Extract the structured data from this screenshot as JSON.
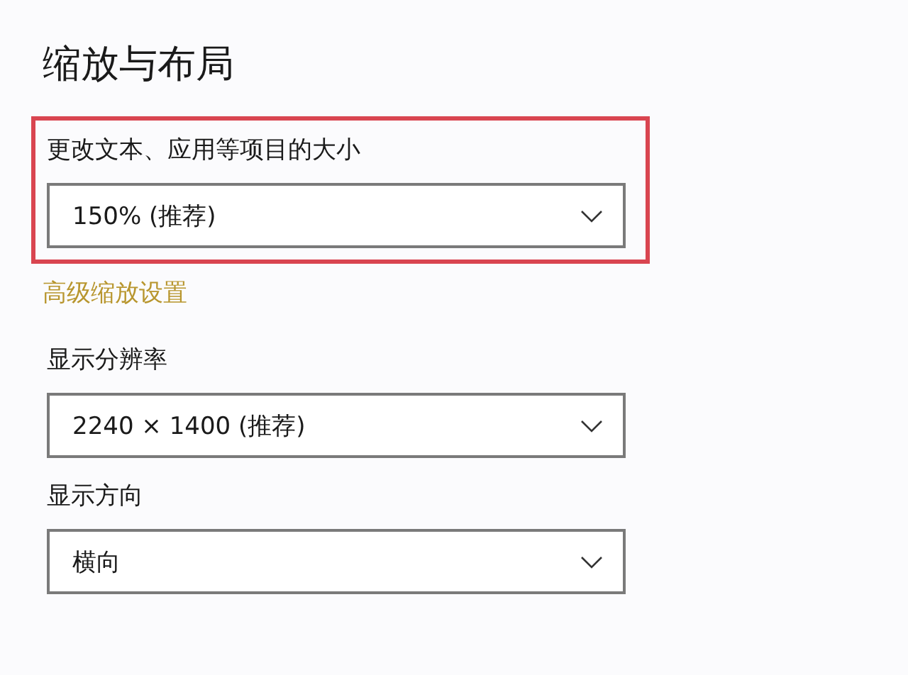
{
  "heading": "缩放与布局",
  "settings": [
    {
      "label": "更改文本、应用等项目的大小",
      "value": "150% (推荐)",
      "highlighted": true,
      "link": "高级缩放设置"
    },
    {
      "label": "显示分辨率",
      "value": "2240 × 1400 (推荐)",
      "highlighted": false
    },
    {
      "label": "显示方向",
      "value": "横向",
      "highlighted": false
    }
  ]
}
